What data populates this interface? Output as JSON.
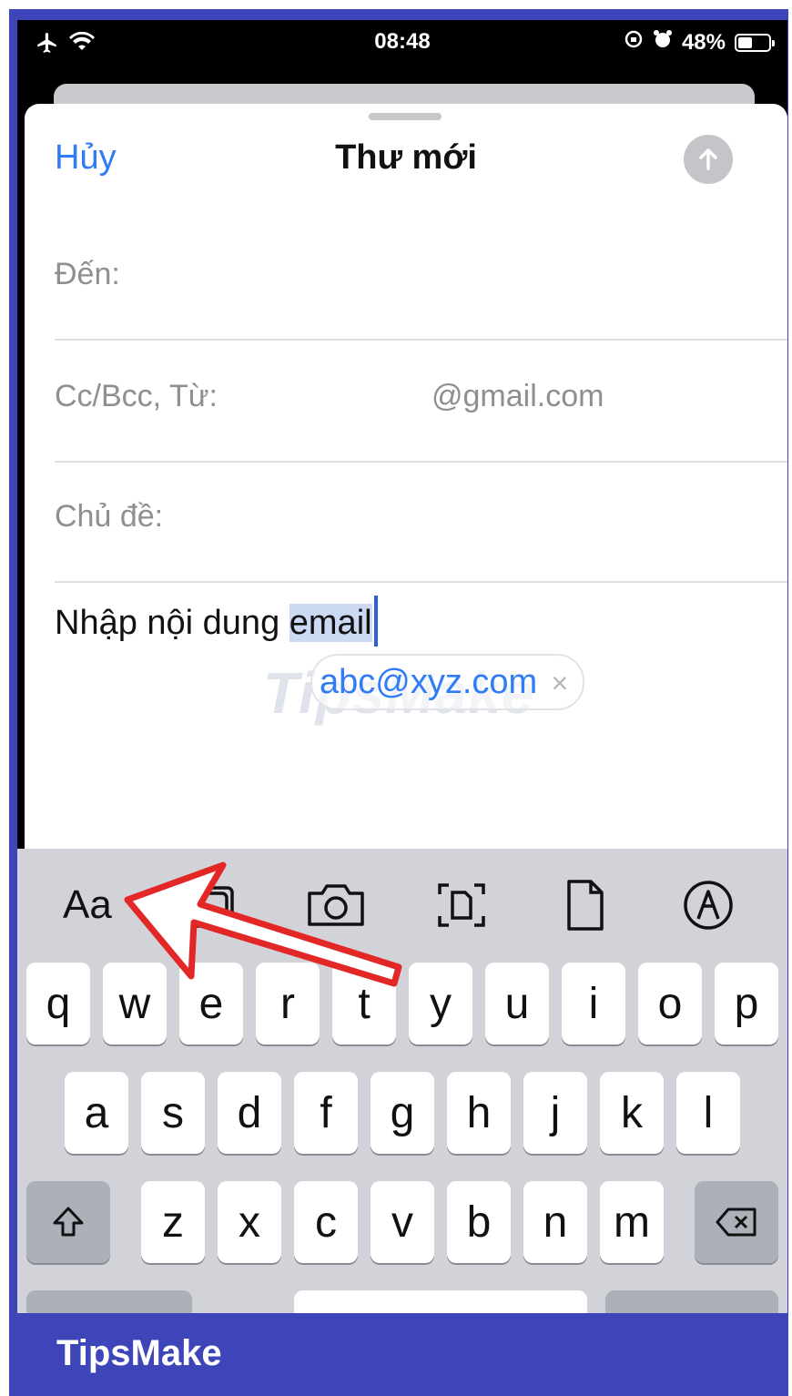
{
  "status_bar": {
    "time": "08:48",
    "battery_percent": "48%",
    "battery_level": 0.48,
    "icons": [
      "airplane-icon",
      "wifi-icon",
      "orientation-lock-icon",
      "alarm-icon",
      "battery-icon"
    ]
  },
  "compose": {
    "cancel_label": "Hủy",
    "title": "Thư mới",
    "to_label": "Đến:",
    "cc_label": "Cc/Bcc, Từ:",
    "from_value": "@gmail.com",
    "subject_label": "Chủ đề:",
    "body_prefix": "Nhập nội dung ",
    "body_selected": "email",
    "suggestion": "abc@xyz.com",
    "suggestion_close": "×",
    "watermark": "TipsMake"
  },
  "keyboard": {
    "toolbar": {
      "format_label": "Aa",
      "icons": [
        "photo-library-icon",
        "camera-icon",
        "scan-document-icon",
        "attach-file-icon",
        "markup-icon"
      ]
    },
    "row1": [
      "q",
      "w",
      "e",
      "r",
      "t",
      "y",
      "u",
      "i",
      "o",
      "p"
    ],
    "row2": [
      "a",
      "s",
      "d",
      "f",
      "g",
      "h",
      "j",
      "k",
      "l"
    ],
    "row3": [
      "z",
      "x",
      "c",
      "v",
      "b",
      "n",
      "m"
    ]
  },
  "colors": {
    "accent": "#2f7cf6",
    "frame": "#3d45b8",
    "arrow": "#e32626"
  },
  "footer": {
    "brand": "TipsMake"
  }
}
